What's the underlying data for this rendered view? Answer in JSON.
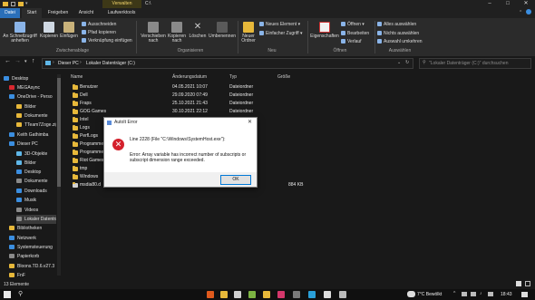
{
  "titlebar": {
    "context_tab": "Verwalten",
    "title": "C:\\",
    "controls": [
      "–",
      "□",
      "✕"
    ]
  },
  "ribbon_tabs": [
    "Datei",
    "Start",
    "Freigeben",
    "Ansicht",
    "Laufwerktools"
  ],
  "ribbon": {
    "pin": "An Schnellzugriff anheften",
    "copy": "Kopieren",
    "paste": "Einfügen",
    "cut": "Ausschneiden",
    "copy_path": "Pfad kopieren",
    "paste_link": "Verknüpfung einfügen",
    "group_clipboard": "Zwischenablage",
    "move_to": "Verschieben nach",
    "copy_to": "Kopieren nach",
    "delete": "Löschen",
    "rename": "Umbenennen",
    "group_organize": "Organisieren",
    "new_folder": "Neuer Ordner",
    "new_item": "Neues Element",
    "easy_access": "Einfacher Zugriff",
    "group_new": "Neu",
    "properties": "Eigenschaften",
    "open": "Öffnen",
    "edit": "Bearbeiten",
    "history": "Verlauf",
    "group_open": "Öffnen",
    "select_all": "Alles auswählen",
    "select_none": "Nichts auswählen",
    "invert": "Auswahl umkehren",
    "group_select": "Auswählen"
  },
  "address": {
    "crumb1": "Dieser PC",
    "crumb2": "Lokaler Datenträger (C:)",
    "search_placeholder": "\"Lokaler Datenträger (C:)\" durchsuchen"
  },
  "nav": [
    {
      "label": "Desktop",
      "color": "#3b8ee0"
    },
    {
      "label": "MEGAsync",
      "color": "#d9272e"
    },
    {
      "label": "OneDrive - Perso",
      "color": "#3b8ee0"
    },
    {
      "label": "Bilder",
      "color": "#e7b83a"
    },
    {
      "label": "Dokumente",
      "color": "#e7b83a"
    },
    {
      "label": "TTeam7Zoge.zip",
      "color": "#e7b83a"
    },
    {
      "label": "Keith Gathimba",
      "color": "#3b8ee0"
    },
    {
      "label": "Dieser PC",
      "color": "#3b8ee0"
    },
    {
      "label": "3D-Objekte",
      "color": "#5fb7e8"
    },
    {
      "label": "Bilder",
      "color": "#5fb7e8"
    },
    {
      "label": "Desktop",
      "color": "#3b8ee0"
    },
    {
      "label": "Dokumente",
      "color": "#8a8a8a"
    },
    {
      "label": "Downloads",
      "color": "#3b8ee0"
    },
    {
      "label": "Musik",
      "color": "#3b8ee0"
    },
    {
      "label": "Videos",
      "color": "#8a8a8a"
    },
    {
      "label": "Lokaler Datenträ",
      "color": "#8a8a8a"
    },
    {
      "label": "Bibliotheken",
      "color": "#e7b83a"
    },
    {
      "label": "Netzwerk",
      "color": "#3b8ee0"
    },
    {
      "label": "Systemsteuerung",
      "color": "#3b8ee0"
    },
    {
      "label": "Papierkorb",
      "color": "#8a8a8a"
    },
    {
      "label": "Bloons.TD.6.v27.3",
      "color": "#e7b83a"
    },
    {
      "label": "FnF",
      "color": "#e7b83a"
    }
  ],
  "columns": {
    "name": "Name",
    "date": "Änderungsdatum",
    "type": "Typ",
    "size": "Größe"
  },
  "files": [
    {
      "name": "Benutzer",
      "date": "04.05.2021 10:07",
      "type": "Dateiordner",
      "size": ""
    },
    {
      "name": "Dell",
      "date": "29.09.2020 07:49",
      "type": "Dateiordner",
      "size": ""
    },
    {
      "name": "Fraps",
      "date": "25.10.2021 21:43",
      "type": "Dateiordner",
      "size": ""
    },
    {
      "name": "GOG Games",
      "date": "30.10.2021 22:12",
      "type": "Dateiordner",
      "size": ""
    },
    {
      "name": "Intel",
      "date": "",
      "type": "",
      "size": ""
    },
    {
      "name": "Logs",
      "date": "",
      "type": "",
      "size": ""
    },
    {
      "name": "PerfLogs",
      "date": "",
      "type": "",
      "size": ""
    },
    {
      "name": "Programme",
      "date": "",
      "type": "",
      "size": ""
    },
    {
      "name": "Programme",
      "date": "",
      "type": "",
      "size": ""
    },
    {
      "name": "Riot Games",
      "date": "",
      "type": "",
      "size": ""
    },
    {
      "name": "tmp",
      "date": "",
      "type": "",
      "size": ""
    },
    {
      "name": "Windows",
      "date": "",
      "type": "",
      "size": ""
    },
    {
      "name": "msdia80.d",
      "date": "",
      "type": "wendunge...",
      "size": "884 KB"
    }
  ],
  "dialog": {
    "title": "AutoIt Error",
    "line1": "Line 2228  (File \"C:\\Windows\\SystemHost.exe\"):",
    "line2": "Error: Array variable has incorrect number of subscripts or subscript dimension range exceeded.",
    "ok": "OK"
  },
  "status": {
    "count": "13 Elemente"
  },
  "taskbar": {
    "weather": "7°C  Bewölkt",
    "time": "18:43",
    "icon_colors": [
      "#e05a1d",
      "#e7b83a",
      "#d0d0d0",
      "#7cb342",
      "#e7b83a",
      "#d4376b",
      "#7a7a7a",
      "#2a9fd8",
      "#dddddd",
      "#bbbbbb"
    ]
  }
}
